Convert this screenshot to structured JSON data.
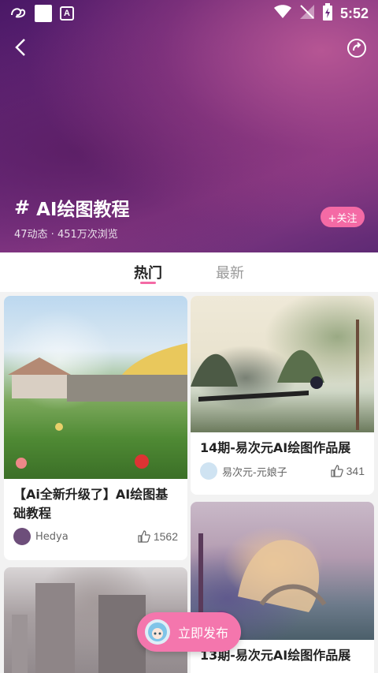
{
  "statusbar": {
    "time": "5:52",
    "a_glyph": "A"
  },
  "topic": {
    "hash": "#",
    "title": "AI绘图教程",
    "stats": "47动态 · 451万次浏览",
    "follow_label": "+关注"
  },
  "tabs": [
    {
      "label": "热门",
      "active": true
    },
    {
      "label": "最新",
      "active": false
    }
  ],
  "posts": [
    {
      "title": "【Ai全新升级了】AI绘图基础教程",
      "author": "Hedya",
      "likes": "1562"
    },
    {
      "title": "14期-易次元AI绘图作品展",
      "author": "易次元-元娘子",
      "likes": "341"
    },
    {
      "title": "13期-易次元AI绘图作品展",
      "author": "",
      "likes": ""
    },
    {
      "title": "",
      "author": "",
      "likes": ""
    }
  ],
  "publish": {
    "label": "立即发布"
  },
  "colors": {
    "accent": "#f46aa5",
    "publish_bg": "#f476ad"
  },
  "icons": {
    "back": "chevron-left-icon",
    "share": "share-icon",
    "like": "thumb-up-icon",
    "wifi": "wifi-icon",
    "battery": "battery-icon"
  }
}
